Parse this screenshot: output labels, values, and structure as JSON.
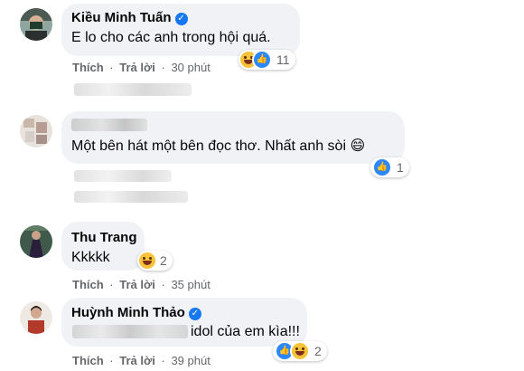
{
  "comments": [
    {
      "author": "Kiều Minh Tuấn",
      "text": "E lo cho các anh trong hội quá.",
      "like": "Thích",
      "reply": "Trả lời",
      "time": "30 phút",
      "reaction_count": "11"
    },
    {
      "author": "",
      "text": "Một bên hát một bên đọc thơ. Nhất anh sòi 😄",
      "reaction_count": "1"
    },
    {
      "author": "Thu Trang",
      "text": "Kkkkk",
      "like": "Thích",
      "reply": "Trả lời",
      "time": "35 phút",
      "reaction_count": "2"
    },
    {
      "author": "Huỳnh Minh Thảo",
      "text": "idol của em kìa!!!",
      "like": "Thích",
      "reply": "Trả lời",
      "time": "39 phút",
      "reaction_count": "2"
    }
  ],
  "icons": {
    "verified": "verified-badge-icon",
    "like": "like-reaction-icon",
    "haha": "haha-reaction-icon"
  },
  "colors": {
    "bubble": "#f0f2f5",
    "meta": "#65676b",
    "like_blue": "#2d88ff",
    "verified_blue": "#1877f2"
  },
  "separator": "·",
  "verified_glyph": "✓",
  "like_glyph": "👍"
}
